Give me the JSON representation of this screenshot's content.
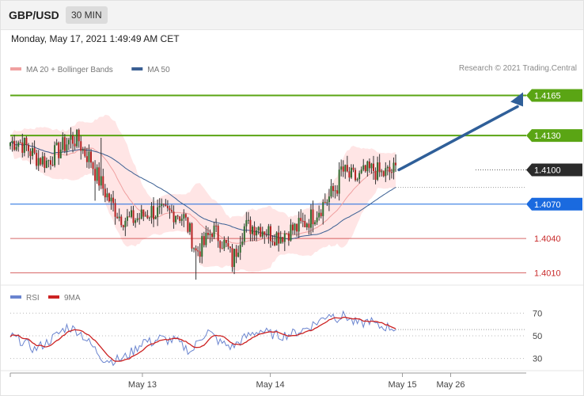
{
  "header": {
    "symbol": "GBP/USD",
    "timeframe": "30 MIN",
    "timestamp": "Monday, May 17, 2021 1:49:49 AM CET",
    "credit": "Research © 2021 Trading.Central"
  },
  "chart_data": [
    {
      "type": "candlestick",
      "legend": [
        {
          "label": "MA 20 + Bollinger Bands",
          "color": "#f0a0a0"
        },
        {
          "label": "MA 50",
          "color": "#3a5f93"
        }
      ],
      "ylim": [
        1.4002,
        1.4182
      ],
      "last_price": 1.41,
      "levels": [
        {
          "value": 1.4165,
          "label": "1.4165",
          "kind": "resistance",
          "color": "#5aa514"
        },
        {
          "value": 1.413,
          "label": "1.4130",
          "kind": "resistance",
          "color": "#5aa514"
        },
        {
          "value": 1.41,
          "label": "1.4100",
          "kind": "last",
          "color": "#2b2b2b"
        },
        {
          "value": 1.407,
          "label": "1.4070",
          "kind": "pivot",
          "color": "#1a6adf"
        },
        {
          "value": 1.404,
          "label": "1.4040",
          "kind": "support",
          "color": "#c82a2a"
        },
        {
          "value": 1.401,
          "label": "1.4010",
          "kind": "support",
          "color": "#c82a2a"
        }
      ],
      "x_ticks": [
        {
          "label": "May 13",
          "pos": 0.315
        },
        {
          "label": "May 14",
          "pos": 0.62
        },
        {
          "label": "May 15",
          "pos": 0.935
        },
        {
          "label": "May 26",
          "pos": 1.05
        }
      ],
      "projection": {
        "from": 1.41,
        "to": 1.4165
      },
      "keypoints": [
        [
          0,
          1.4124
        ],
        [
          4,
          1.4125
        ],
        [
          8,
          1.412
        ],
        [
          12,
          1.4112
        ],
        [
          18,
          1.4107
        ],
        [
          24,
          1.4117
        ],
        [
          30,
          1.4127
        ],
        [
          34,
          1.4126
        ],
        [
          36,
          1.4117
        ],
        [
          40,
          1.4109
        ],
        [
          42,
          1.4098
        ],
        [
          46,
          1.4084
        ],
        [
          50,
          1.4071
        ],
        [
          54,
          1.406
        ],
        [
          58,
          1.4056
        ],
        [
          62,
          1.4057
        ],
        [
          66,
          1.406
        ],
        [
          70,
          1.4064
        ],
        [
          74,
          1.4062
        ],
        [
          78,
          1.4062
        ],
        [
          82,
          1.4063
        ],
        [
          86,
          1.4058
        ],
        [
          88,
          1.405
        ],
        [
          90,
          1.404
        ],
        [
          92,
          1.4028
        ],
        [
          96,
          1.4035
        ],
        [
          100,
          1.4048
        ],
        [
          104,
          1.404
        ],
        [
          108,
          1.403
        ],
        [
          110,
          1.402
        ],
        [
          112,
          1.403
        ],
        [
          114,
          1.4042
        ],
        [
          116,
          1.405
        ],
        [
          118,
          1.405
        ],
        [
          122,
          1.4051
        ],
        [
          126,
          1.4048
        ],
        [
          130,
          1.4043
        ],
        [
          134,
          1.4043
        ],
        [
          138,
          1.4047
        ],
        [
          142,
          1.4049
        ],
        [
          146,
          1.4054
        ],
        [
          150,
          1.406
        ],
        [
          154,
          1.4068
        ],
        [
          158,
          1.4076
        ],
        [
          162,
          1.4086
        ],
        [
          164,
          1.41
        ],
        [
          168,
          1.4094
        ],
        [
          172,
          1.4092
        ],
        [
          176,
          1.4098
        ],
        [
          180,
          1.41
        ],
        [
          184,
          1.4096
        ],
        [
          188,
          1.4098
        ],
        [
          191,
          1.41
        ]
      ]
    },
    {
      "type": "line",
      "legend": [
        {
          "label": "RSI",
          "color": "#6a84cf"
        },
        {
          "label": "9MA",
          "color": "#cc2222"
        }
      ],
      "ylim": [
        22,
        78
      ],
      "y_ticks": [
        70,
        50,
        30
      ],
      "keypoints": [
        [
          0,
          50
        ],
        [
          6,
          45
        ],
        [
          12,
          38
        ],
        [
          18,
          44
        ],
        [
          24,
          52
        ],
        [
          28,
          58
        ],
        [
          34,
          54
        ],
        [
          38,
          46
        ],
        [
          42,
          38
        ],
        [
          46,
          30
        ],
        [
          50,
          28
        ],
        [
          56,
          30
        ],
        [
          62,
          38
        ],
        [
          66,
          46
        ],
        [
          70,
          44
        ],
        [
          74,
          48
        ],
        [
          78,
          46
        ],
        [
          82,
          46
        ],
        [
          86,
          40
        ],
        [
          90,
          36
        ],
        [
          94,
          48
        ],
        [
          98,
          54
        ],
        [
          104,
          44
        ],
        [
          110,
          40
        ],
        [
          116,
          48
        ],
        [
          120,
          52
        ],
        [
          124,
          55
        ],
        [
          128,
          52
        ],
        [
          134,
          50
        ],
        [
          140,
          52
        ],
        [
          146,
          56
        ],
        [
          150,
          60
        ],
        [
          154,
          64
        ],
        [
          158,
          70
        ],
        [
          162,
          66
        ],
        [
          166,
          68
        ],
        [
          170,
          62
        ],
        [
          174,
          60
        ],
        [
          178,
          64
        ],
        [
          182,
          58
        ],
        [
          186,
          58
        ],
        [
          190,
          57
        ]
      ]
    }
  ]
}
